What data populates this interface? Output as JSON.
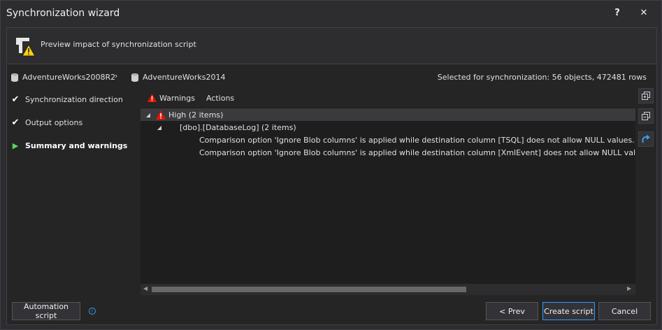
{
  "window": {
    "title": "Synchronization wizard",
    "help": "?",
    "close": "✕"
  },
  "header": {
    "text": "Preview impact of synchronization script"
  },
  "databases": {
    "source": "AdventureWorks2008R2",
    "separator": "›",
    "target": "AdventureWorks2014",
    "selected_info": "Selected for synchronization: 56 objects, 472481 rows"
  },
  "steps": [
    {
      "label": "Synchronization direction",
      "mark": "✔"
    },
    {
      "label": "Output options",
      "mark": "✔"
    },
    {
      "label": "Summary and warnings",
      "mark": "▶"
    }
  ],
  "tabs": {
    "warnings": "Warnings",
    "actions": "Actions"
  },
  "tree": {
    "group": "High (2 items)",
    "object": "[dbo].[DatabaseLog] (2 items)",
    "messages": [
      "Comparison option 'Ignore Blob columns' is applied while destination column [TSQL] does not allow NULL values. This may cause script execution errors.",
      "Comparison option 'Ignore Blob columns' is applied while destination column [XmlEvent] does not allow NULL values. This may cause script execution errors."
    ]
  },
  "footer": {
    "automation": "Automation script",
    "info": "i",
    "prev": "< Prev",
    "create": "Create script",
    "cancel": "Cancel"
  },
  "colors": {
    "accent": "#3399ff",
    "warning": "#e51400",
    "warning_fill": "#f8d012",
    "check": "#ffffff",
    "active_arrow": "#5cd65c"
  }
}
